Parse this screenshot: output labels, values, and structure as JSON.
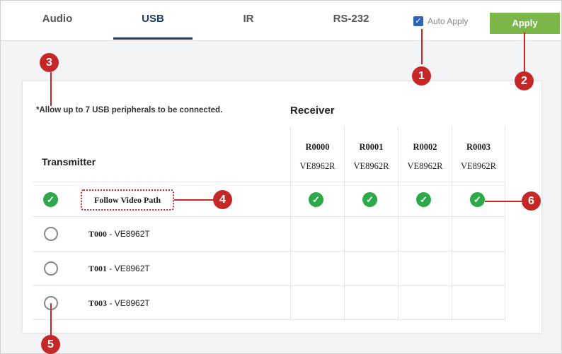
{
  "tabs": [
    {
      "label": "Audio",
      "active": false
    },
    {
      "label": "USB",
      "active": true
    },
    {
      "label": "IR",
      "active": false
    },
    {
      "label": "RS-232",
      "active": false
    }
  ],
  "auto_apply": {
    "label": "Auto Apply",
    "checked": true
  },
  "apply_button": {
    "label": "Apply"
  },
  "note": "*Allow up to 7 USB peripherals to be connected.",
  "receiver_title": "Receiver",
  "transmitter_title": "Transmitter",
  "receivers": [
    {
      "id": "R0000",
      "model": "VE8962R"
    },
    {
      "id": "R0001",
      "model": "VE8962R"
    },
    {
      "id": "R0002",
      "model": "VE8962R"
    },
    {
      "id": "R0003",
      "model": "VE8962R"
    }
  ],
  "rows": [
    {
      "label": "Follow Video Path",
      "selected": true
    },
    {
      "id": "T000",
      "model": "VE8962T",
      "selected": false
    },
    {
      "id": "T001",
      "model": "VE8962T",
      "selected": false
    },
    {
      "id": "T003",
      "model": "VE8962T",
      "selected": false
    }
  ],
  "callouts": [
    "1",
    "2",
    "3",
    "4",
    "5",
    "6"
  ],
  "colors": {
    "accent": "#2ea84a",
    "apply": "#7ab648",
    "callout": "#c62828",
    "tab_active": "#1f3c66"
  }
}
